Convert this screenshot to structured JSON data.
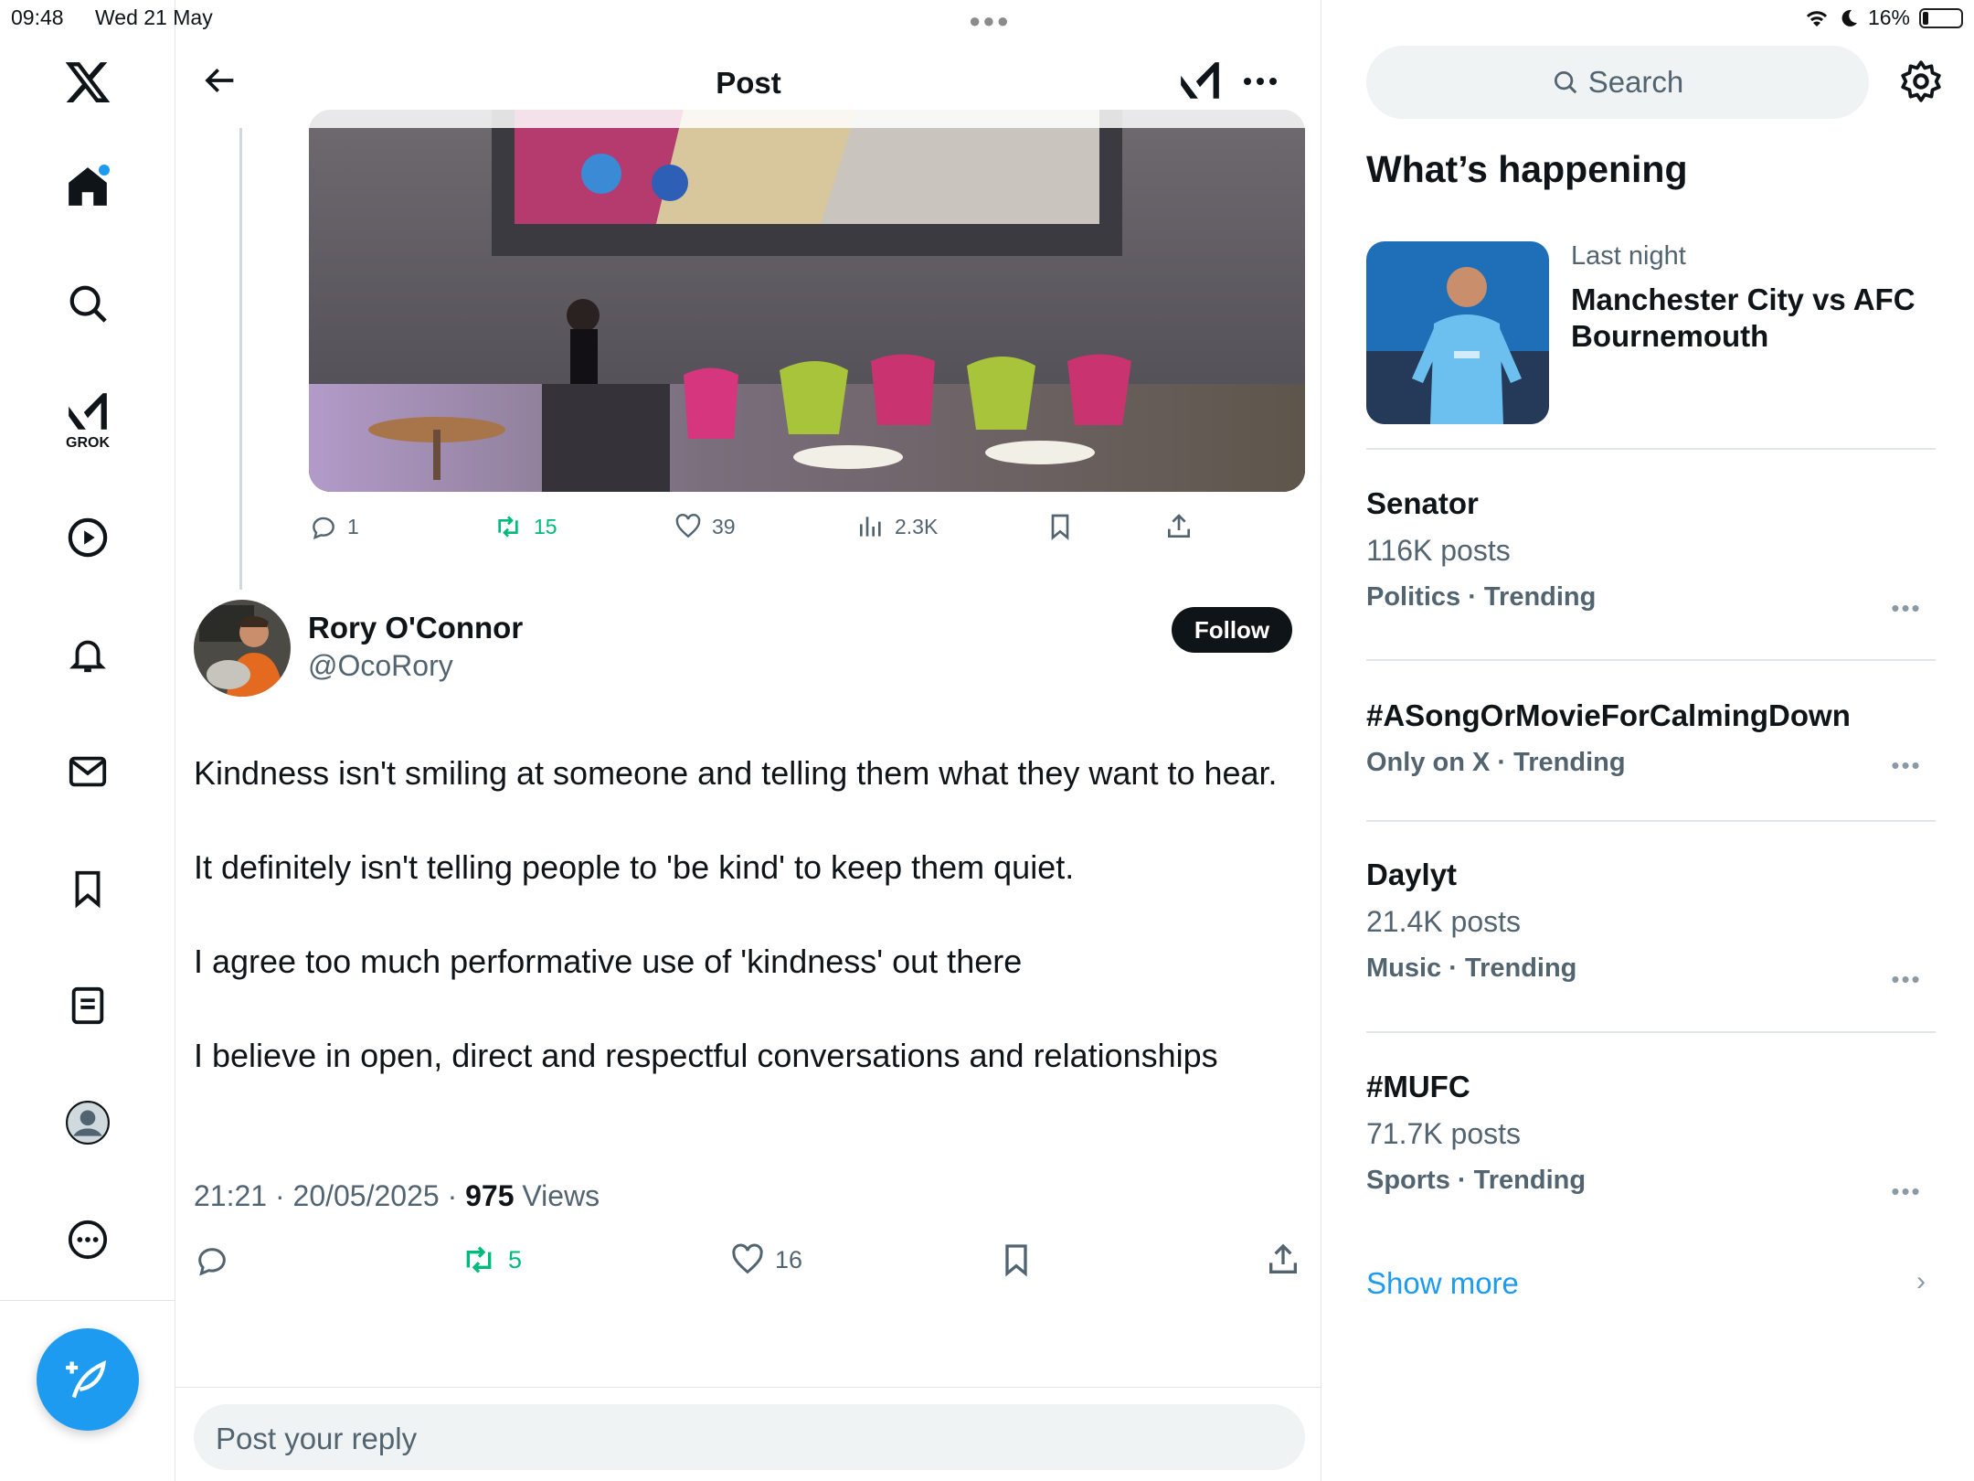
{
  "status": {
    "time": "09:48",
    "date": "Wed 21 May",
    "battery": "16%",
    "battery_level": 0.16
  },
  "nav": {
    "grok_label": "GROK"
  },
  "header": {
    "title": "Post"
  },
  "quoted_post": {
    "replies": "1",
    "reposts": "15",
    "likes": "39",
    "views": "2.3K"
  },
  "post": {
    "author_name": "Rory O'Connor",
    "author_handle": "@OcoRory",
    "follow_label": "Follow",
    "paragraphs": [
      "Kindness isn't smiling at someone and telling them what they want to hear.",
      "It definitely isn't telling people to 'be kind' to keep them quiet.",
      "I agree too much performative use of 'kindness' out there",
      "I believe in open, direct and respectful conversations and relationships"
    ],
    "timestamp": "21:21 · 20/05/2025 · ",
    "views_count": "975",
    "views_label": " Views",
    "reposts": "5",
    "likes": "16"
  },
  "reply": {
    "placeholder": "Post your reply"
  },
  "sidebar": {
    "search_placeholder": "Search",
    "section_title": "What’s happening",
    "event": {
      "meta": "Last night",
      "title": "Manchester City vs AFC Bournemouth"
    },
    "trends": [
      {
        "title": "Senator",
        "posts": "116K posts",
        "category": "Politics · Trending"
      },
      {
        "title": "#ASongOrMovieForCalmingDown",
        "posts": "",
        "category": "Only on X · Trending"
      },
      {
        "title": "Daylyt",
        "posts": "21.4K posts",
        "category": "Music · Trending"
      },
      {
        "title": "#MUFC",
        "posts": "71.7K posts",
        "category": "Sports · Trending"
      }
    ],
    "show_more": "Show more"
  },
  "colors": {
    "accent": "#1d9bf0",
    "repost_green": "#00ba7c",
    "muted": "#536471"
  }
}
